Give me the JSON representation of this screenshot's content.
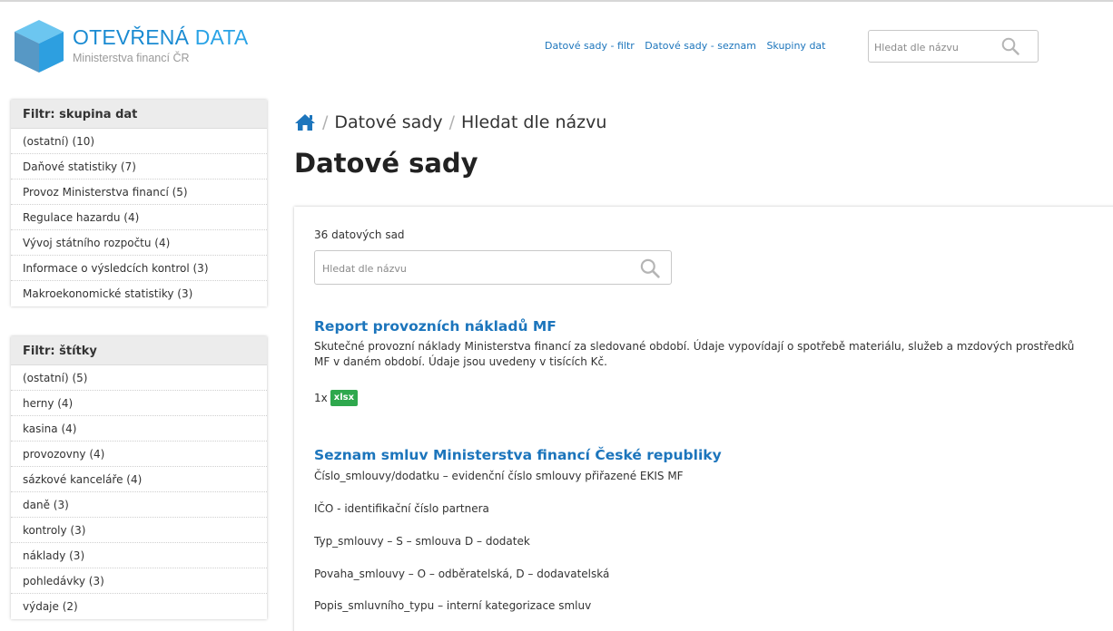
{
  "header": {
    "logo_title_bold": "OTEVŘENÁ",
    "logo_title_light": "DATA",
    "logo_subtitle": "Ministerstva financí ČR",
    "nav": [
      "Datové sady - filtr",
      "Datové sady - seznam",
      "Skupiny dat"
    ],
    "search_placeholder": "Hledat dle názvu"
  },
  "sidebar": {
    "groups": {
      "title": "Filtr: skupina dat",
      "items": [
        "(ostatní) (10)",
        "Daňové statistiky (7)",
        "Provoz Ministerstva financí (5)",
        "Regulace hazardu (4)",
        "Vývoj státního rozpočtu (4)",
        "Informace o výsledcích kontrol (3)",
        "Makroekonomické statistiky (3)"
      ]
    },
    "tags": {
      "title": "Filtr: štítky",
      "items": [
        "(ostatní) (5)",
        "herny (4)",
        "kasina (4)",
        "provozovny (4)",
        "sázkové kanceláře (4)",
        "daně (3)",
        "kontroly (3)",
        "náklady (3)",
        "pohledávky (3)",
        "výdaje (2)"
      ]
    }
  },
  "breadcrumb": {
    "item1": "Datové sady",
    "item2": "Hledat dle názvu",
    "separator": "/"
  },
  "page_title": "Datové sady",
  "results": {
    "count": "36 datových sad",
    "search_placeholder": "Hledat dle názvu",
    "datasets": [
      {
        "title": "Report provozních nákladů MF",
        "description": "Skutečné provozní náklady Ministerstva financí za sledované období. Údaje vypovídají o spotřebě materiálu, služeb a mzdových prostředků MF v daném období. Údaje jsou uvedeny v tisících Kč.",
        "format_count": "1x",
        "format_label": "xlsx"
      },
      {
        "title": "Seznam smluv Ministerstva financí České republiky",
        "lines": [
          "Číslo_smlouvy/dodatku – evidenční číslo smlouvy přiřazené EKIS MF",
          "IČO - identifikační číslo partnera",
          "Typ_smlouvy – S – smlouva D – dodatek",
          "Povaha_smlouvy – O – odběratelská, D – dodavatelská",
          "Popis_smluvního_typu – interní kategorizace smluv"
        ]
      }
    ]
  },
  "colors": {
    "link": "#1c75bc",
    "badge": "#2ea84d",
    "logo": "#1a8bd2"
  },
  "icons": [
    "logo-cube-icon",
    "search-icon",
    "home-icon"
  ]
}
